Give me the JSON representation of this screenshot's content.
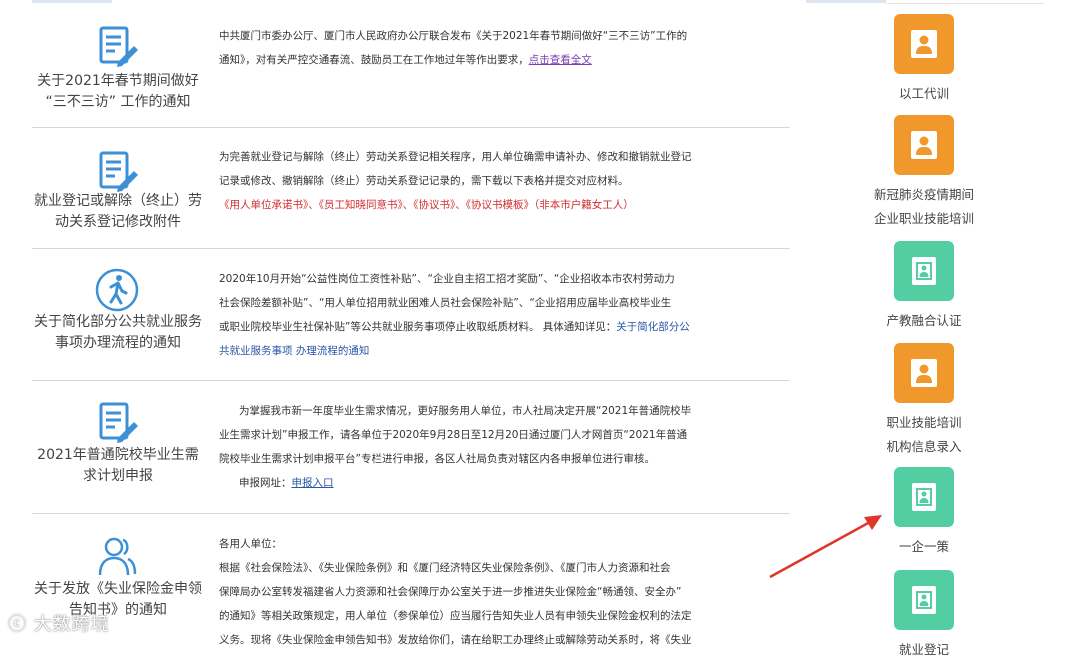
{
  "notices": [
    {
      "title": "关于2021年春节期间做好“三不三访”工作的通知",
      "title_lines": [
        "关于2021年春节期间做好",
        "“三不三访” 工作的通知"
      ],
      "icon": "document-edit-icon",
      "desc": {
        "line1": "中共厦门市委办公厅、厦门市人民政府办公厅联合发布《关于2021年春节期间做好“三不三访”工作的",
        "line2_prefix": "通知》，对有关严控交通春流、鼓励员工在工作地过年等作出要求，",
        "line2_link": "点击查看全文"
      }
    },
    {
      "title_lines": [
        "就业登记或解除（终止）劳",
        "动关系登记修改附件"
      ],
      "icon": "document-edit-icon",
      "desc": {
        "line1": "为完善就业登记与解除（终止）劳动关系登记相关程序，用人单位确需申请补办、修改和撤销就业登记",
        "line2": "记录或修改、撤销解除（终止）劳动关系登记记录的，需下载以下表格并提交对应材料。",
        "line3_red": "《用人单位承诺书》、《员工知晓同意书》、《协议书》、《协议书模板》（非本市户籍女工人）"
      }
    },
    {
      "title_lines": [
        "关于简化部分公共就业服务",
        "事项办理流程的通知"
      ],
      "icon": "walking-person-icon",
      "desc": {
        "line1": "2020年10月开始“公益性岗位工资性补贴”、“企业自主招工招才奖励”、“企业招收本市农村劳动力",
        "line2": "社会保险差额补贴”、“用人单位招用就业困难人员社会保险补贴”、“企业招用应届毕业高校毕业生",
        "line3_prefix": "或职业院校毕业生社保补贴”等公共就业服务事项停止收取纸质材料。 具体通知详见：",
        "line3_blue": "关于简化部分公",
        "line4_blue": "共就业服务事项 办理流程的通知"
      }
    },
    {
      "title_lines": [
        "2021年普通院校毕业生需",
        "求计划申报"
      ],
      "icon": "document-edit-icon",
      "desc": {
        "line1": "为掌握我市新一年度毕业生需求情况，更好服务用人单位，市人社局决定开展“2021年普通院校毕",
        "line2": "业生需求计划”申报工作，请各单位于2020年9月28日至12月20日通过厦门人才网首页“2021年普通",
        "line3": "院校毕业生需求计划申报平台”专栏进行申报，各区人社局负责对辖区内各申报单位进行审核。",
        "line4_prefix": "申报网址：",
        "line4_link": "申报入口"
      }
    },
    {
      "title_lines": [
        "关于发放《失业保险金申领",
        "告知书》的通知"
      ],
      "icon": "people-icon",
      "desc": {
        "line1": "各用人单位：",
        "line2": "根据《社会保险法》、《失业保险条例》和《厦门经济特区失业保险条例》、《厦门市人力资源和社会",
        "line3": "保障局办公室转发福建省人力资源和社会保障厅办公室关于进一步推进失业保险金“畅通领、安全办”",
        "line4": "的通知》等相关政策规定，用人单位（参保单位）应当履行告知失业人员有申领失业保险金权利的法定",
        "line5": "义务。现将《失业保险金申领告知书》发放给你们，请在给职工办理终止或解除劳动关系时，将《失业"
      }
    }
  ],
  "sidebar": [
    {
      "label_lines": [
        "以工代训"
      ],
      "color": "#f1982c",
      "icon": "person-badge-icon"
    },
    {
      "label_lines": [
        "新冠肺炎疫情期间",
        "企业职业技能培训"
      ],
      "color": "#f1982c",
      "icon": "person-badge-icon"
    },
    {
      "label_lines": [
        "产教融合认证"
      ],
      "color": "#53cea3",
      "icon": "id-card-icon"
    },
    {
      "label_lines": [
        "职业技能培训",
        "机构信息录入"
      ],
      "color": "#f1982c",
      "icon": "person-badge-icon"
    },
    {
      "label_lines": [
        "一企一策"
      ],
      "color": "#53cea3",
      "icon": "id-card-icon"
    },
    {
      "label_lines": [
        "就业登记"
      ],
      "color": "#53cea3",
      "icon": "id-card-icon"
    }
  ],
  "watermark": "大数跨境",
  "colors": {
    "accent_blue": "#3d8fd6",
    "orange": "#f1982c",
    "green": "#53cea3",
    "arrow": "#e0352b"
  }
}
